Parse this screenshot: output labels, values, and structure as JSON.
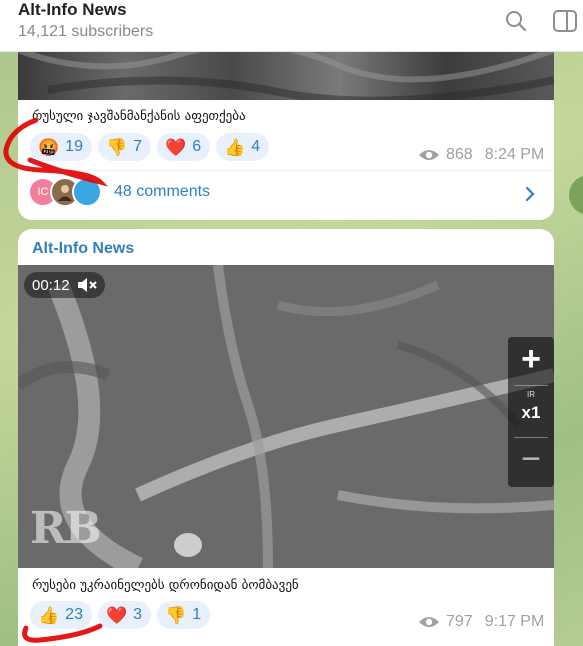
{
  "header": {
    "title": "Alt-Info News",
    "subscribers": "14,121 subscribers",
    "icons": [
      "search-icon",
      "side-panel-icon"
    ]
  },
  "post1": {
    "caption": "რუსული ჯავშანმანქანის აფეთქება",
    "reactions": [
      {
        "emoji": "🤬",
        "count": "19"
      },
      {
        "emoji": "👎",
        "count": "7"
      },
      {
        "emoji": "❤️",
        "count": "6"
      },
      {
        "emoji": "👍",
        "count": "4"
      }
    ],
    "views": "868",
    "time": "8:24 PM",
    "comments": {
      "avatar_initials": "IC",
      "label": "48 comments"
    }
  },
  "post2": {
    "channel": "Alt-Info News",
    "video": {
      "duration": "00:12",
      "zoom_plus": "+",
      "zoom_mode": "IR",
      "zoom_level": "x1",
      "zoom_minus": "−",
      "watermark": "RB"
    },
    "caption": "რუსები უკრაინელებს დრონიდან ბომბავენ",
    "reactions": [
      {
        "emoji": "👍",
        "count": "23"
      },
      {
        "emoji": "❤️",
        "count": "3"
      },
      {
        "emoji": "👎",
        "count": "1"
      }
    ],
    "views": "797",
    "time": "9:17 PM"
  },
  "colors": {
    "accent": "#2f7fc1",
    "annotation": "#e00000",
    "reaction_bg": "#e8f1fb"
  }
}
